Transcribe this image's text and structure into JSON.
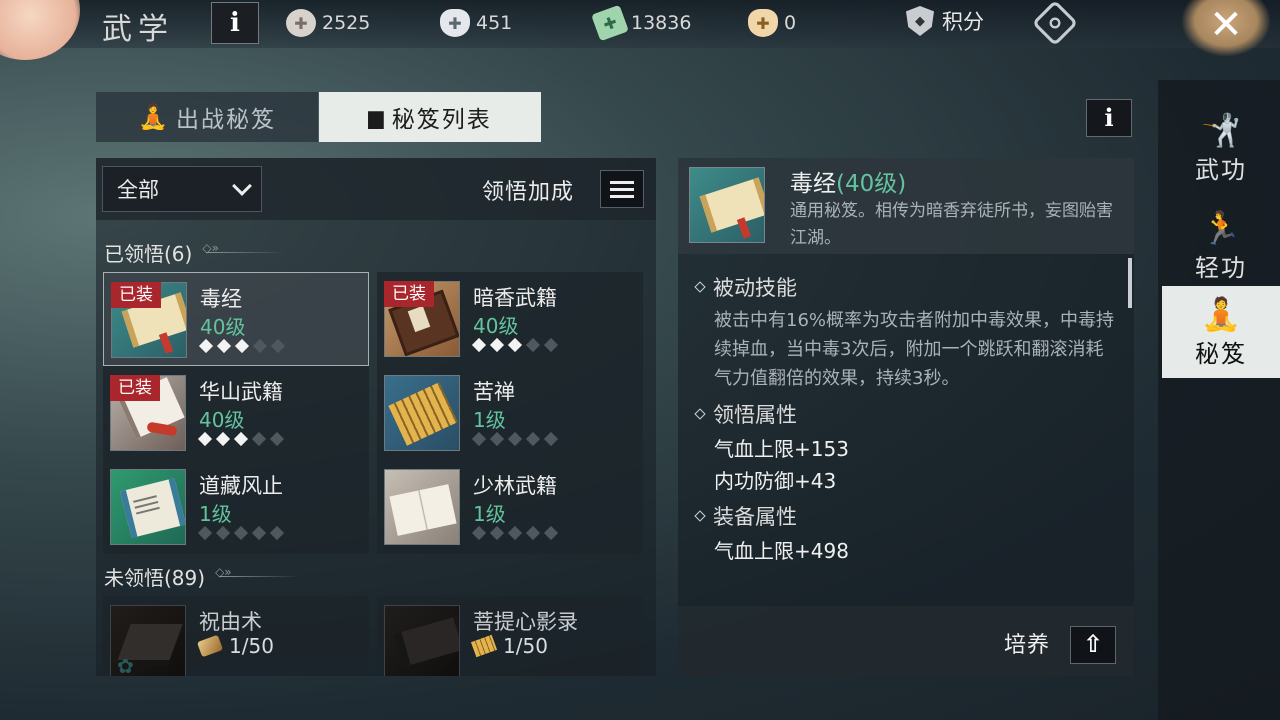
{
  "header": {
    "title": "武学",
    "info_label": "i",
    "currencies": [
      {
        "name": "silver-coin-icon",
        "value": "2525"
      },
      {
        "name": "silver-ingot-icon",
        "value": "451"
      },
      {
        "name": "jade-note-icon",
        "value": "13836"
      },
      {
        "name": "gold-ingot-icon",
        "value": "0"
      }
    ],
    "score_label": "积分",
    "close_label": "✕"
  },
  "tabs": [
    {
      "label": "出战秘笈",
      "active": false
    },
    {
      "label": "秘笈列表",
      "active": true
    }
  ],
  "filter": {
    "selected": "全部",
    "bonus_label": "领悟加成"
  },
  "learned": {
    "title": "已领悟(6)",
    "items": [
      {
        "name": "毒经",
        "level": "40级",
        "equipped": "已装",
        "stars_on": 3,
        "stars_total": 5,
        "selected": true
      },
      {
        "name": "暗香武籍",
        "level": "40级",
        "equipped": "已装",
        "stars_on": 3,
        "stars_total": 5
      },
      {
        "name": "华山武籍",
        "level": "40级",
        "equipped": "已装",
        "stars_on": 3,
        "stars_total": 5
      },
      {
        "name": "苦禅",
        "level": "1级",
        "equipped": "",
        "stars_on": 0,
        "stars_total": 5
      },
      {
        "name": "道藏风止",
        "level": "1级",
        "equipped": "",
        "stars_on": 0,
        "stars_total": 5
      },
      {
        "name": "少林武籍",
        "level": "1级",
        "equipped": "",
        "stars_on": 0,
        "stars_total": 5
      }
    ]
  },
  "unlearned": {
    "title": "未领悟(89)",
    "items": [
      {
        "name": "祝由术",
        "progress": "1/50"
      },
      {
        "name": "菩提心影录",
        "progress": "1/50"
      }
    ]
  },
  "detail": {
    "name": "毒经",
    "level": "(40级)",
    "description": "通用秘笈。相传为暗香弃徒所书，妄图贻害江湖。",
    "passive_title": "被动技能",
    "passive_text": "被击中有16%概率为攻击者附加中毒效果，中毒持续掉血，当中毒3次后，附加一个跳跃和翻滚消耗气力值翻倍的效果，持续3秒。",
    "comprehend_title": "领悟属性",
    "comprehend_attrs": [
      "气血上限+153",
      "内功防御+43"
    ],
    "equip_title": "装备属性",
    "equip_attrs": [
      "气血上限+498"
    ],
    "cultivate_label": "培养",
    "cultivate_icon": "⇧"
  },
  "side_nav": [
    {
      "label": "武功",
      "icon": "martial-figure-icon",
      "active": false
    },
    {
      "label": "轻功",
      "icon": "running-figure-icon",
      "active": false
    },
    {
      "label": "秘笈",
      "icon": "meditation-figure-icon",
      "active": true
    }
  ]
}
